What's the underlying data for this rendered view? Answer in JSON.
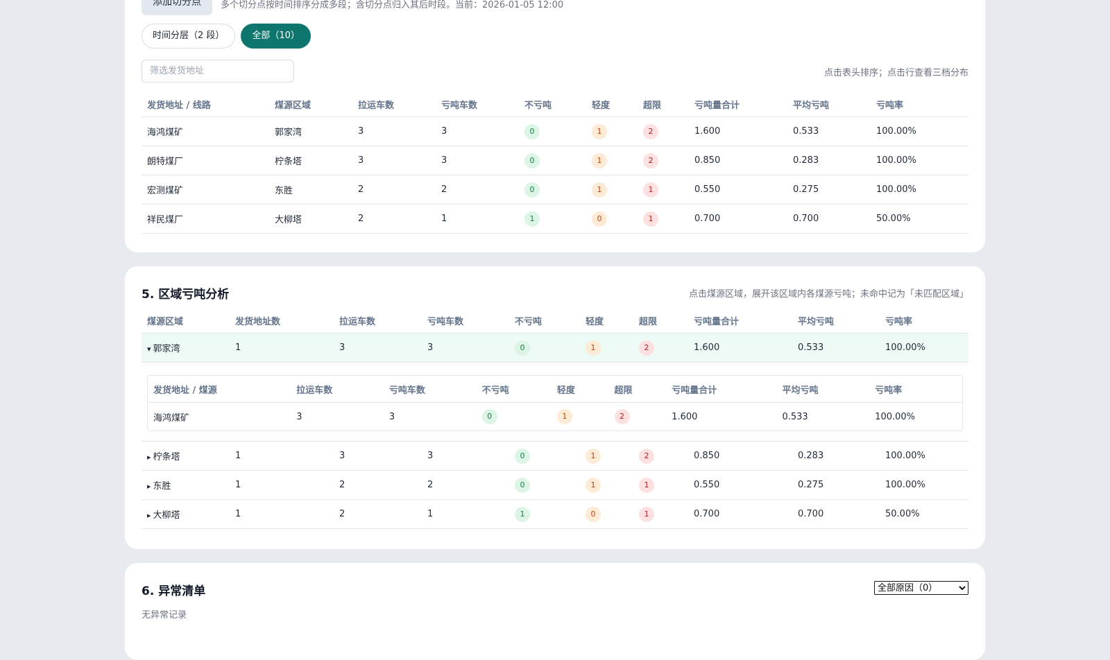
{
  "section4": {
    "add_button": "添加切分点",
    "hint": "多个切分点按时间排序分成多段；含切分点归入其后时段。当前：2026-01-05 12:00",
    "pills": [
      "时间分层（2 段）",
      "全部（10）"
    ],
    "filter_placeholder": "筛选发货地址",
    "filter_value": "",
    "sort_hint": "点击表头排序；点击行查看三档分布",
    "columns": [
      "发货地址 / 线路",
      "煤源区域",
      "拉运车数",
      "亏吨车数",
      "不亏吨",
      "轻度",
      "超限",
      "亏吨量合计",
      "平均亏吨",
      "亏吨率"
    ],
    "rows": [
      [
        "海鸿煤矿",
        "郭家湾",
        "3",
        "3",
        "0",
        "1",
        "2",
        "1.600",
        "0.533",
        "100.00%"
      ],
      [
        "朗特煤厂",
        "柠条塔",
        "3",
        "3",
        "0",
        "1",
        "2",
        "0.850",
        "0.283",
        "100.00%"
      ],
      [
        "宏测煤矿",
        "东胜",
        "2",
        "2",
        "0",
        "1",
        "1",
        "0.550",
        "0.275",
        "100.00%"
      ],
      [
        "祥民煤厂",
        "大柳塔",
        "2",
        "1",
        "1",
        "0",
        "1",
        "0.700",
        "0.700",
        "50.00%"
      ]
    ]
  },
  "section5": {
    "title": "5. 区域亏吨分析",
    "hint": "点击煤源区域，展开该区域内各煤源亏吨；未命中记为「未匹配区域」",
    "columns": [
      "煤源区域",
      "发货地址数",
      "拉运车数",
      "亏吨车数",
      "不亏吨",
      "轻度",
      "超限",
      "亏吨量合计",
      "平均亏吨",
      "亏吨率"
    ],
    "expanded_row": [
      "郭家湾",
      "1",
      "3",
      "3",
      "0",
      "1",
      "2",
      "1.600",
      "0.533",
      "100.00%"
    ],
    "expanded_caret": "▾",
    "collapsed_caret": "▸",
    "sub_columns": [
      "发货地址 / 煤源",
      "拉运车数",
      "亏吨车数",
      "不亏吨",
      "轻度",
      "超限",
      "亏吨量合计",
      "平均亏吨",
      "亏吨率"
    ],
    "sub_rows": [
      [
        "海鸿煤矿",
        "3",
        "3",
        "0",
        "1",
        "2",
        "1.600",
        "0.533",
        "100.00%"
      ]
    ],
    "rows": [
      [
        "柠条塔",
        "1",
        "3",
        "3",
        "0",
        "1",
        "2",
        "0.850",
        "0.283",
        "100.00%"
      ],
      [
        "东胜",
        "1",
        "2",
        "2",
        "0",
        "1",
        "1",
        "0.550",
        "0.275",
        "100.00%"
      ],
      [
        "大柳塔",
        "1",
        "2",
        "1",
        "1",
        "0",
        "1",
        "0.700",
        "0.700",
        "50.00%"
      ]
    ]
  },
  "section6": {
    "title": "6. 异常清单",
    "select_value": "全部原因（0）",
    "empty_text": "无异常记录"
  },
  "colors": {
    "accent": "#0f766e",
    "badge_ok": "#15803d",
    "badge_light": "#c2410c",
    "badge_over": "#b91c1c",
    "expanded_row_bg": "#eefaf6"
  }
}
